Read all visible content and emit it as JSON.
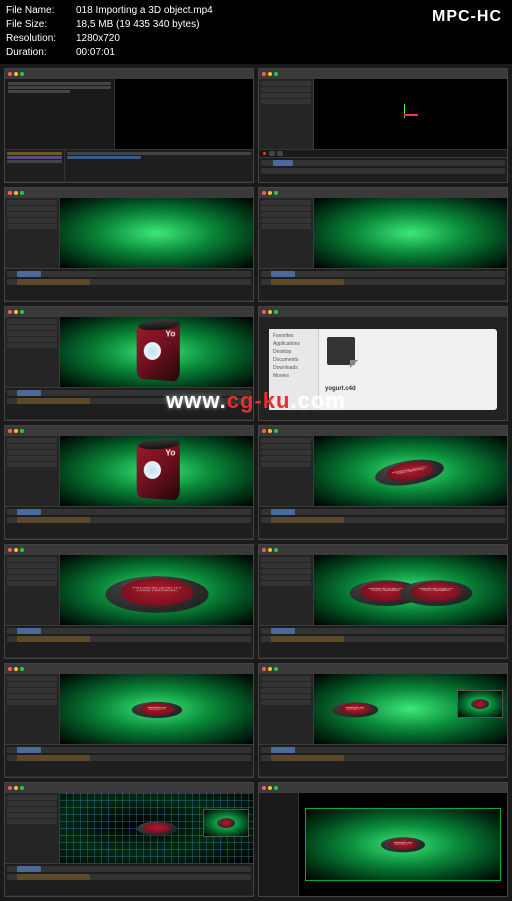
{
  "player_name": "MPC-HC",
  "header": {
    "file_name_label": "File Name:",
    "file_name": "018 Importing a 3D object.mp4",
    "file_size_label": "File Size:",
    "file_size": "18,5 MB (19 435 340 bytes)",
    "resolution_label": "Resolution:",
    "resolution": "1280x720",
    "duration_label": "Duration:",
    "duration": "00:07:01"
  },
  "watermark": {
    "prefix": "www.",
    "mid": "cg-ku",
    "suffix": ".com"
  },
  "dialog": {
    "sidebar": [
      "Favorites",
      "Applications",
      "Desktop",
      "Documents",
      "Downloads",
      "Movies"
    ],
    "filename": "yogurt.c4d"
  },
  "cup_label": "Yo",
  "disc_label_line1": "PREMIUM QUALITY",
  "disc_label_line2": "100% ORGANIC"
}
